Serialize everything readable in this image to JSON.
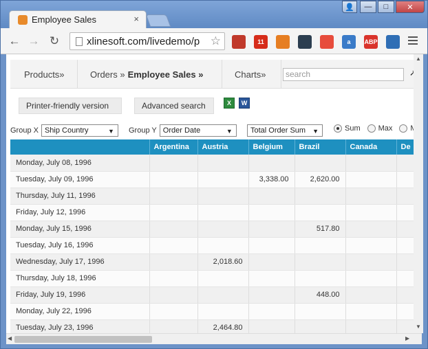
{
  "browser": {
    "tab_title": "Employee Sales",
    "tab_close": "×",
    "url": "xlinesoft.com/livedemo/p",
    "window_controls": {
      "user": "👤",
      "minimize": "—",
      "maximize": "□",
      "close": "✕"
    },
    "extensions": [
      {
        "name": "bookmark-red",
        "color": "#c0392b",
        "label": ""
      },
      {
        "name": "calendar-badge",
        "color": "#d62c1a",
        "label": "11"
      },
      {
        "name": "pet-icon",
        "color": "#e67e22",
        "label": ""
      },
      {
        "name": "speedometer",
        "color": "#2c3e50",
        "label": ""
      },
      {
        "name": "stop-sign",
        "color": "#e74c3c",
        "label": ""
      },
      {
        "name": "amazon-a",
        "color": "#3a7bc8",
        "label": "a"
      },
      {
        "name": "adblock-plus",
        "color": "#d9332b",
        "label": "ABP"
      },
      {
        "name": "globe",
        "color": "#2f6eb5",
        "label": ""
      }
    ]
  },
  "menu": {
    "products": "Products»",
    "orders_prefix": "Orders »",
    "orders_current": "Employee Sales »",
    "charts": "Charts»",
    "search_placeholder": "search"
  },
  "actions": {
    "printer_friendly": "Printer-friendly version",
    "advanced_search": "Advanced search"
  },
  "controls": {
    "group_x_label": "Group X",
    "group_x_value": "Ship Country",
    "group_y_label": "Group Y",
    "group_y_value": "Order Date",
    "aggregate_value": "Total Order Sum",
    "radios": [
      {
        "label": "Sum",
        "checked": true
      },
      {
        "label": "Max",
        "checked": false
      },
      {
        "label": "Min",
        "checked": false
      }
    ]
  },
  "table": {
    "columns": [
      "",
      "Argentina",
      "Austria",
      "Belgium",
      "Brazil",
      "Canada",
      "De"
    ],
    "rows": [
      {
        "date": "Monday, July 08, 1996",
        "values": [
          "",
          "",
          "",
          "",
          "",
          ""
        ]
      },
      {
        "date": "Tuesday, July 09, 1996",
        "values": [
          "",
          "",
          "3,338.00",
          "2,620.00",
          "",
          ""
        ]
      },
      {
        "date": "Thursday, July 11, 1996",
        "values": [
          "",
          "",
          "",
          "",
          "",
          ""
        ]
      },
      {
        "date": "Friday, July 12, 1996",
        "values": [
          "",
          "",
          "",
          "",
          "",
          ""
        ]
      },
      {
        "date": "Monday, July 15, 1996",
        "values": [
          "",
          "",
          "",
          "517.80",
          "",
          ""
        ]
      },
      {
        "date": "Tuesday, July 16, 1996",
        "values": [
          "",
          "",
          "",
          "",
          "",
          ""
        ]
      },
      {
        "date": "Wednesday, July 17, 1996",
        "values": [
          "",
          "2,018.60",
          "",
          "",
          "",
          ""
        ]
      },
      {
        "date": "Thursday, July 18, 1996",
        "values": [
          "",
          "",
          "",
          "",
          "",
          ""
        ]
      },
      {
        "date": "Friday, July 19, 1996",
        "values": [
          "",
          "",
          "",
          "448.00",
          "",
          ""
        ]
      },
      {
        "date": "Monday, July 22, 1996",
        "values": [
          "",
          "",
          "",
          "",
          "",
          ""
        ]
      },
      {
        "date": "Tuesday, July 23, 1996",
        "values": [
          "",
          "2,464.80",
          "",
          "",
          "",
          ""
        ]
      }
    ]
  }
}
